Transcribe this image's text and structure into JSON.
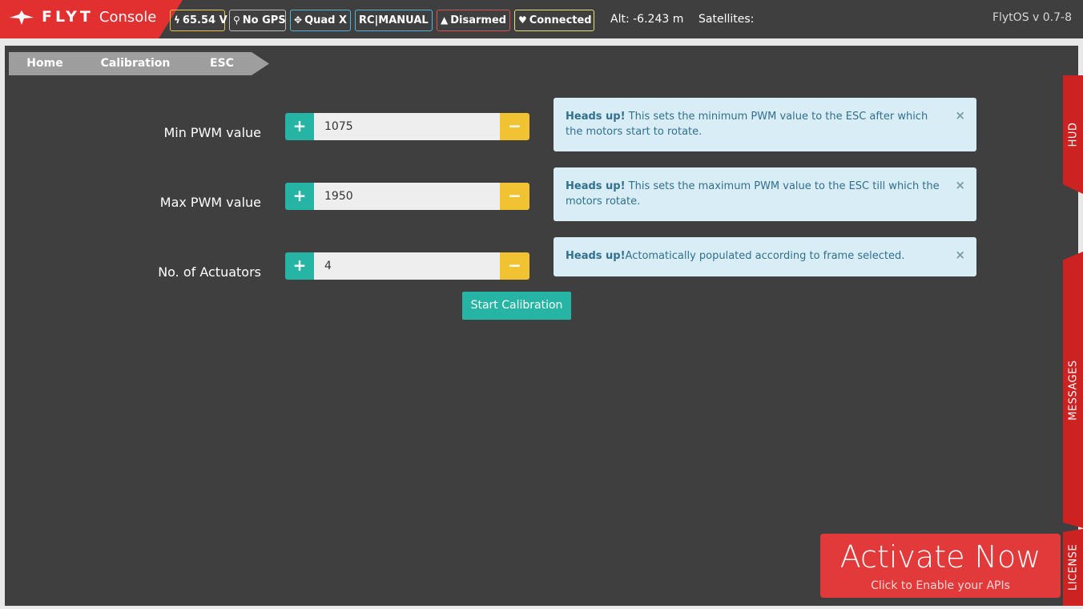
{
  "app": {
    "logo_text_bold": "FLYT",
    "logo_text_light": "Console",
    "brand_color": "#e23030"
  },
  "status": {
    "voltage": "65.54 V",
    "gps": "No GPS",
    "frame": "Quad X",
    "rc_mode": "RC|MANUAL",
    "arm_state": "Disarmed",
    "connection": "Connected",
    "altitude": "Alt: -6.243 m",
    "satellites": "Satellites:",
    "version": "FlytOS v 0.7-8"
  },
  "breadcrumb": [
    "Home",
    "Calibration",
    "ESC"
  ],
  "form": {
    "rows": [
      {
        "label": "Min PWM value",
        "value": "1075",
        "alert_title": "Heads up!",
        "alert_text": " This sets the minimum PWM value to the ESC after which the motors start to rotate."
      },
      {
        "label": "Max PWM value",
        "value": "1950",
        "alert_title": "Heads up!",
        "alert_text": " This sets the maximum PWM value to the ESC till which the motors rotate."
      },
      {
        "label": "No. of Actuators",
        "value": "4",
        "alert_title": "Heads up!",
        "alert_text": "Actomatically populated according to frame selected."
      }
    ],
    "start_button": "Start Calibration",
    "plus_symbol": "+",
    "minus_symbol": "−",
    "close_symbol": "×"
  },
  "side_tabs": {
    "hud": "HUD",
    "messages": "MESSAGES",
    "license": "LICENSE"
  },
  "activate": {
    "title": "Activate Now",
    "subtitle": "Click to Enable your APIs"
  },
  "colors": {
    "plus": "#26b5a4",
    "minus": "#f1c232",
    "alert_bg": "#d9edf7",
    "alert_text": "#31708f",
    "panel": "#3f3f3f"
  }
}
